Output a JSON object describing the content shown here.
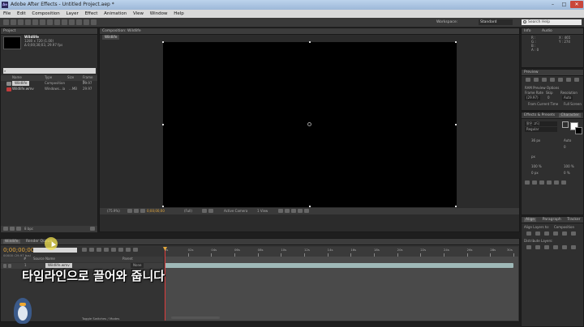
{
  "window": {
    "title": "Adobe After Effects - Untitled Project.aep *",
    "app_badge": "Ae"
  },
  "menu": [
    "File",
    "Edit",
    "Composition",
    "Layer",
    "Effect",
    "Animation",
    "View",
    "Window",
    "Help"
  ],
  "toolbar": {
    "workspace_label": "Workspace:",
    "workspace_value": "Standard",
    "search_placeholder": "Search Help"
  },
  "project": {
    "tab": "Project",
    "item_name": "Wildlife",
    "item_size": "1280 x 720 (1.00)",
    "item_duration": "Δ 0;00;30;03, 29.97 fps",
    "columns": [
      "Name",
      "Type",
      "Size",
      "Frame R..."
    ],
    "rows": [
      {
        "name": "Wildlife",
        "type": "Composition",
        "size": "",
        "fps": "29.97"
      },
      {
        "name": "Wildlife.wmv",
        "type": "Windows...ia",
        "size": "...MB",
        "fps": "29.97"
      }
    ],
    "bpc": "8 bpc"
  },
  "composition": {
    "tab": "Composition: Wildlife",
    "breadcrumb": "Wildlife",
    "zoom": "(75.9%)",
    "quality": "(Full)",
    "camera": "Active Camera",
    "views": "1 View",
    "timecode": "0;00;00;00"
  },
  "info": {
    "tabs": [
      "Info",
      "Audio"
    ],
    "r": "R :",
    "g": "G :",
    "b": "B :",
    "a": "A : 0",
    "x": "X : 465",
    "y": "Y : 274"
  },
  "preview": {
    "tab": "Preview",
    "ram_options": "RAM Preview Options",
    "labels": [
      "Frame Rate",
      "Skip",
      "Resolution"
    ],
    "values": [
      "(29.97)",
      "0",
      "Auto"
    ],
    "from_current": "From Current Time",
    "full_screen": "Full Screen"
  },
  "effects": {
    "tabs": [
      "Effects & Presets",
      "Character"
    ],
    "font": "맑은 고딕",
    "style": "Regular",
    "size_value": "36 px",
    "leading": "Auto",
    "tracking": "0",
    "px": "px",
    "scale_v": "100 %",
    "scale_h": "100 %",
    "baseline": "0 px",
    "tsume": "0 %"
  },
  "align": {
    "tabs": [
      "Align",
      "Paragraph",
      "Tracker"
    ],
    "align_layers_to": "Align Layers to:",
    "align_target": "Composition",
    "distribute": "Distribute Layers:"
  },
  "timeline": {
    "tabs": [
      "Wildlife",
      "Render Queue"
    ],
    "timecode": "0;00;00;00",
    "frames": "00000 (29.97 fps)",
    "search_placeholder": "",
    "columns": [
      "#",
      "Source Name",
      "Parent"
    ],
    "layer": {
      "index": "1",
      "name": "Wildlife.wmv",
      "parent": "None"
    },
    "ruler_ticks": [
      "0s",
      "02s",
      "04s",
      "06s",
      "08s",
      "10s",
      "12s",
      "14s",
      "16s",
      "18s",
      "20s",
      "22s",
      "24s",
      "26s",
      "28s",
      "30s"
    ],
    "toggle_label": "Toggle Switches / Modes"
  },
  "caption": "타임라인으로 끌어와 줍니다",
  "colors": {
    "timecode": "#e3a73d",
    "layer_bar": "#9fb9b8",
    "playhead": "#e03b3b",
    "cursor_highlight": "#f2e14f"
  }
}
